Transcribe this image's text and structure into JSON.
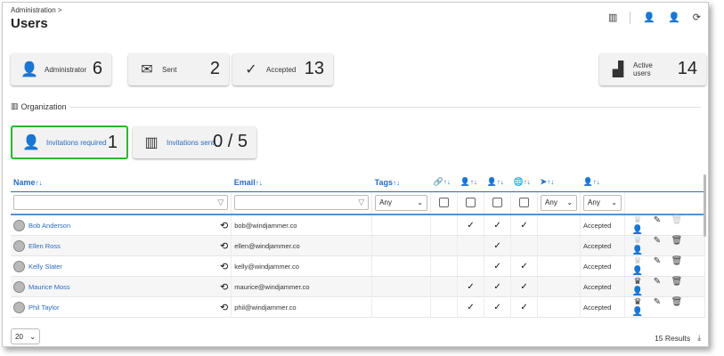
{
  "breadcrumb": "Administration >",
  "title": "Users",
  "stats": [
    {
      "label": "Administrator",
      "value": "6",
      "icon": "admin-user-icon"
    },
    {
      "label": "Sent",
      "value": "2",
      "icon": "envelope-icon"
    },
    {
      "label": "Accepted",
      "value": "13",
      "icon": "checkmark-icon"
    },
    {
      "label": "Active users",
      "value": "14",
      "icon": "bar-chart-icon"
    }
  ],
  "organization": {
    "label": "Organization",
    "cards": [
      {
        "label": "Invitations required",
        "value": "1"
      },
      {
        "label": "Invitations sent",
        "value": "0 / 5"
      }
    ]
  },
  "table": {
    "headers": {
      "name": "Name",
      "email": "Email",
      "tags": "Tags"
    },
    "filters": {
      "tags": "Any",
      "status": "Any",
      "accepted": "Any"
    },
    "rows": [
      {
        "name": "Bob Anderson",
        "email": "bob@windjammer.co",
        "c1": "",
        "c2": "✓",
        "c3": "✓",
        "c4": "✓",
        "status": "Accepted"
      },
      {
        "name": "Ellen Ross",
        "email": "ellen@windjammer.co",
        "c1": "",
        "c2": "",
        "c3": "✓",
        "c4": "",
        "status": "Accepted"
      },
      {
        "name": "Kelly Slater",
        "email": "kelly@windjammer.co",
        "c1": "",
        "c2": "",
        "c3": "✓",
        "c4": "✓",
        "status": "Accepted"
      },
      {
        "name": "Maurice Moss",
        "email": "maurice@windjammer.co",
        "c1": "",
        "c2": "✓",
        "c3": "✓",
        "c4": "✓",
        "status": "Accepted"
      },
      {
        "name": "Phil Taylor",
        "email": "phil@windjammer.co",
        "c1": "",
        "c2": "✓",
        "c3": "✓",
        "c4": "✓",
        "status": "Accepted"
      }
    ]
  },
  "footer": {
    "page_size": "20",
    "results": "15 Results"
  }
}
